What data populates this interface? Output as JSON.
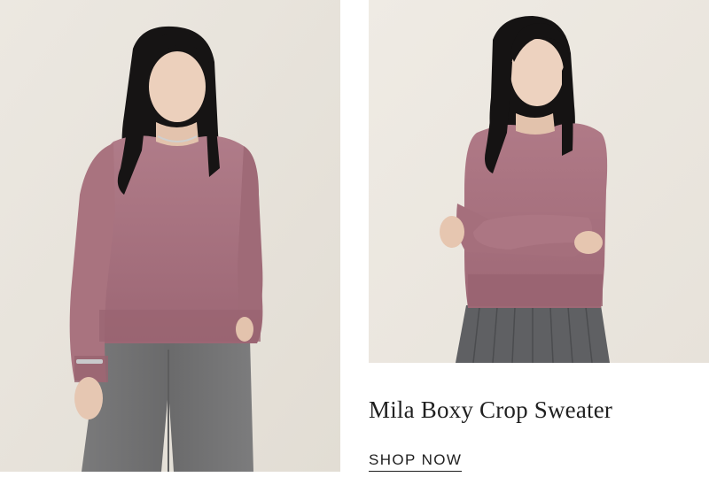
{
  "product": {
    "title": "Mila Boxy Crop Sweater",
    "cta_label": "SHOP NOW"
  },
  "images": {
    "left": "model-front-pose",
    "right": "model-arms-crossed"
  },
  "colors": {
    "sweater": "#a8727f",
    "background_left": "#e9e5dd",
    "background_right": "#ede9e2",
    "trousers": "#6f6f70",
    "text": "#1f1f1f"
  }
}
